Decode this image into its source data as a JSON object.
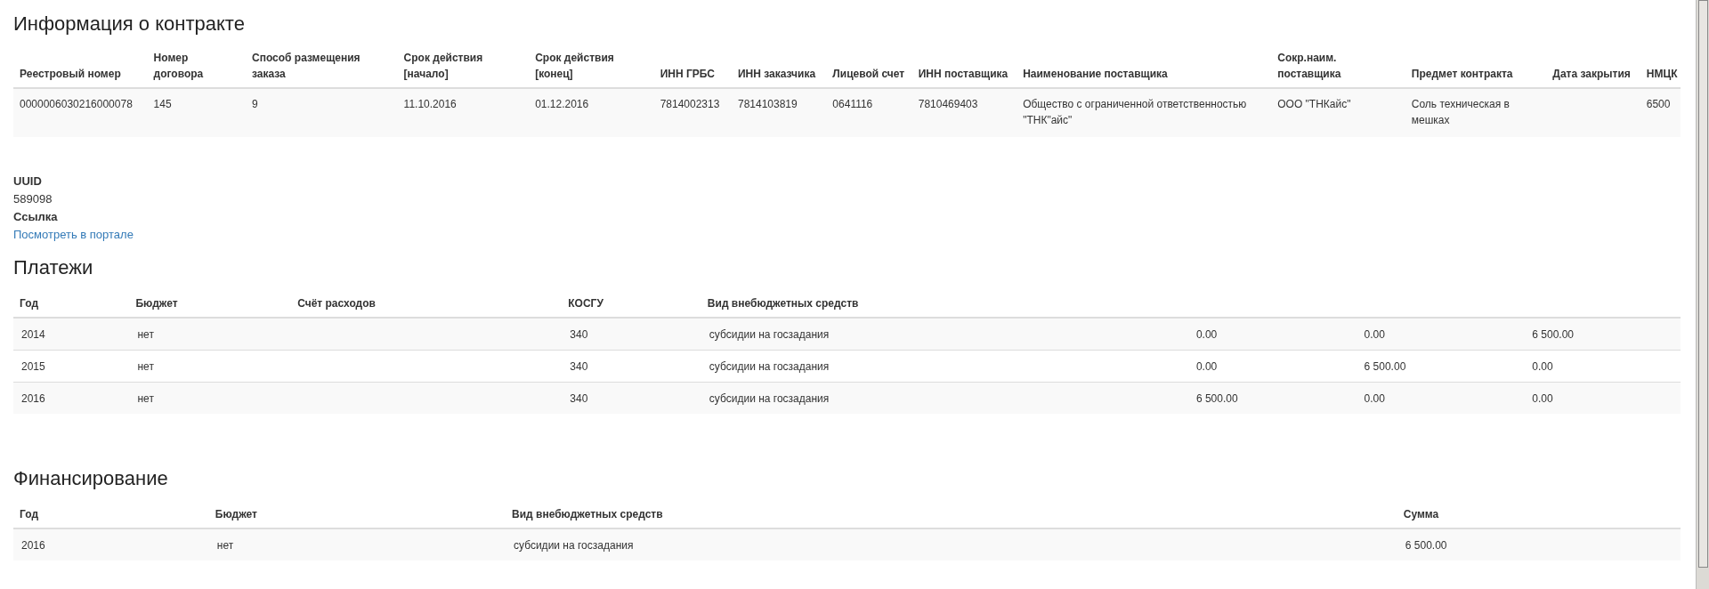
{
  "contract": {
    "title": "Информация о контракте",
    "columns": [
      "Реестровый номер",
      "Номер договора",
      "Способ размещения заказа",
      "Срок действия [начало]",
      "Срок действия [конец]",
      "ИНН ГРБС",
      "ИНН заказчика",
      "Лицевой счет",
      "ИНН поставщика",
      "Наименование поставщика",
      "Сокр.наим. поставщика",
      "Предмет контракта",
      "Дата закрытия",
      "НМЦК"
    ],
    "rows": [
      [
        "0000006030216000078",
        "145",
        "9",
        "11.10.2016",
        "01.12.2016",
        "7814002313",
        "7814103819",
        "0641116",
        "7810469403",
        "Общество с ограниченной ответственностью \"ТНК\"айс\"",
        "ООО \"ТНКайс\"",
        "Соль техническая в мешках",
        "",
        "6500"
      ]
    ]
  },
  "details": {
    "uuid_label": "UUID",
    "uuid": "589098",
    "link_label": "Ссылка",
    "link": "Посмотреть в портале"
  },
  "payments": {
    "title": "Платежи",
    "columns": [
      "Год",
      "Бюджет",
      "Счёт расходов",
      "КОСГУ",
      "Вид внебюджетных средств"
    ],
    "rows": [
      [
        "2014",
        "нет",
        "",
        "340",
        "субсидии на госзадания",
        "0.00",
        "0.00",
        "6 500.00"
      ],
      [
        "2015",
        "нет",
        "",
        "340",
        "субсидии на госзадания",
        "0.00",
        "6 500.00",
        "0.00"
      ],
      [
        "2016",
        "нет",
        "",
        "340",
        "субсидии на госзадания",
        "6 500.00",
        "0.00",
        "0.00"
      ]
    ]
  },
  "financing": {
    "title": "Финансирование",
    "columns": [
      "Год",
      "Бюджет",
      "Вид внебюджетных средств",
      "Сумма"
    ],
    "rows": [
      [
        "2016",
        "нет",
        "субсидии на госзадания",
        "6 500.00"
      ]
    ]
  }
}
